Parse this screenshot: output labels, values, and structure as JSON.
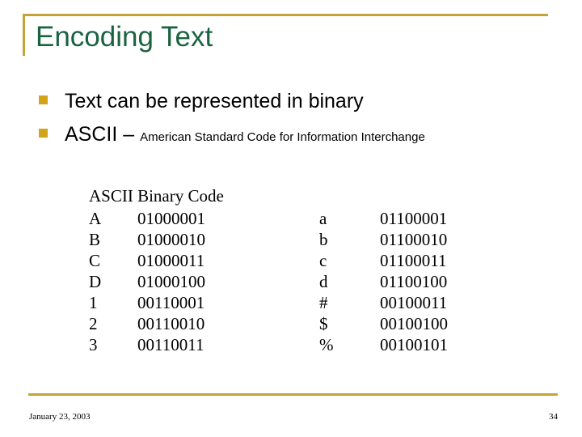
{
  "slide": {
    "title": "Encoding Text",
    "accent_color": "#c4a434",
    "title_color": "#1a6340",
    "bullet_color": "#d3a41a",
    "background_color": "#ffffff"
  },
  "bullets": [
    {
      "marker": "square-bullet",
      "text": "Text can be represented in binary",
      "sub": ""
    },
    {
      "marker": "square-bullet",
      "text": "ASCII – ",
      "sub": "American Standard Code for Information Interchange"
    }
  ],
  "ascii_table": {
    "caption": "ASCII Binary Code",
    "rows": [
      {
        "char_a": "A",
        "bits_a": "01000001",
        "char_b": "a",
        "bits_b": "01100001"
      },
      {
        "char_a": "B",
        "bits_a": "01000010",
        "char_b": "b",
        "bits_b": "01100010"
      },
      {
        "char_a": "C",
        "bits_a": "01000011",
        "char_b": "c",
        "bits_b": "01100011"
      },
      {
        "char_a": "D",
        "bits_a": "01000100",
        "char_b": "d",
        "bits_b": "01100100"
      },
      {
        "char_a": "1",
        "bits_a": "00110001",
        "char_b": "#",
        "bits_b": "00100011"
      },
      {
        "char_a": "2",
        "bits_a": "00110010",
        "char_b": "$",
        "bits_b": "00100100"
      },
      {
        "char_a": "3",
        "bits_a": "00110011",
        "char_b": "%",
        "bits_b": "00100101"
      }
    ]
  },
  "footer": {
    "date": "January 23, 2003",
    "page_number": "34"
  }
}
